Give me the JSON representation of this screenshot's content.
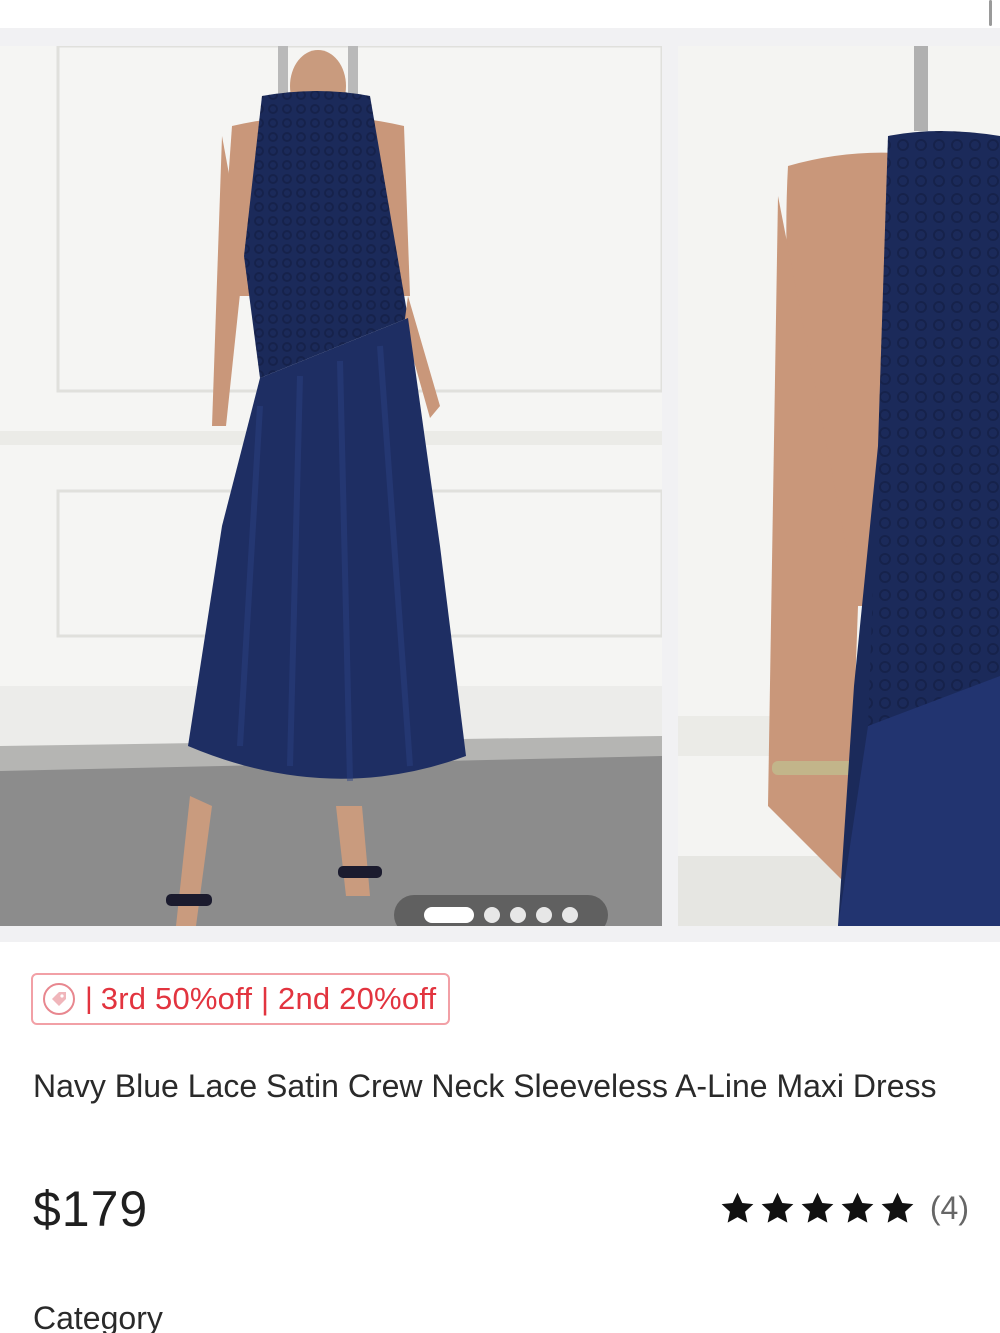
{
  "product": {
    "title": "Navy Blue Lace Satin Crew Neck Sleeveless A-Line Maxi Dress",
    "price": "$179",
    "rating": {
      "stars": 5,
      "count_label": "(4)"
    }
  },
  "gallery": {
    "slide_count": 5,
    "active_index": 0,
    "dress_color": "#1b2a5a"
  },
  "promo": {
    "icon": "tag-icon",
    "separator": "|",
    "text": "3rd 50%off | 2nd 20%off",
    "color": "#e2343f"
  },
  "sections": {
    "category_label": "Category"
  }
}
